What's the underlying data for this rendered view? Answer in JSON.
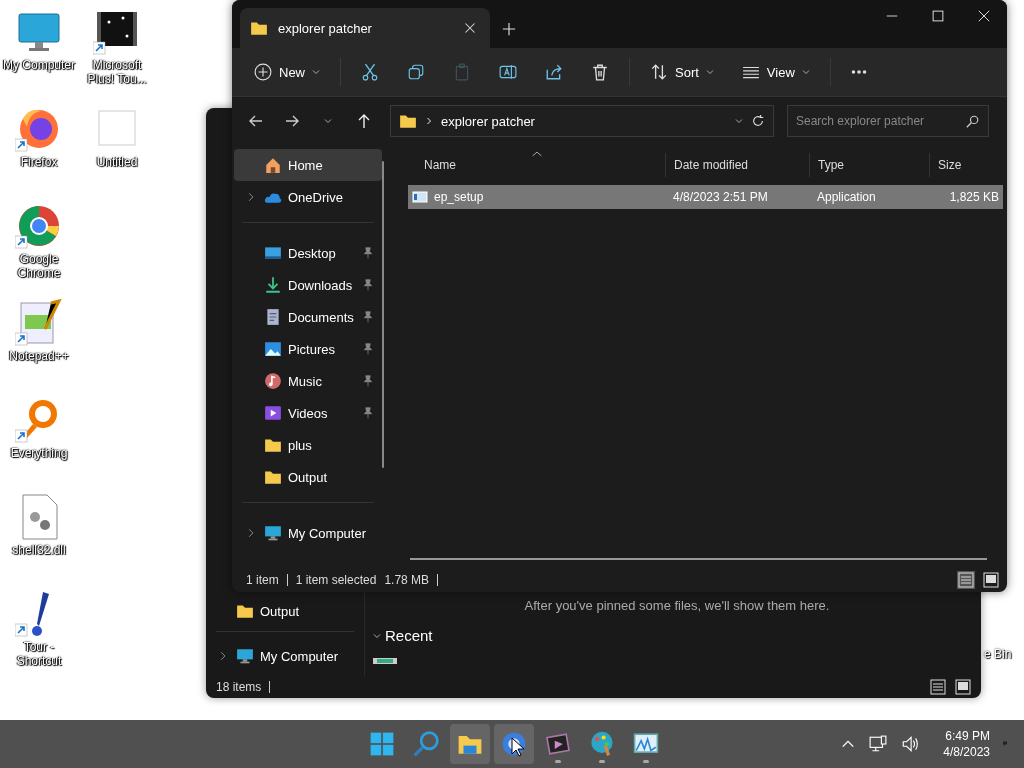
{
  "desktop": {
    "icon_columns": [
      [
        {
          "label": "My Computer",
          "kind": "monitor",
          "shortcut": false
        },
        {
          "label": "Firefox",
          "kind": "firefox",
          "shortcut": true
        },
        {
          "label": "Google Chrome",
          "kind": "chrome",
          "shortcut": true
        },
        {
          "label": "Notepad++",
          "kind": "notepad",
          "shortcut": true
        },
        {
          "label": "Everything",
          "kind": "everything",
          "shortcut": true
        },
        {
          "label": "shell32.dll",
          "kind": "dll",
          "shortcut": false
        },
        {
          "label": "Tour - Shortcut",
          "kind": "tour",
          "shortcut": true
        }
      ],
      [
        {
          "label": "Microsoft Plus! Tou...",
          "kind": "plus",
          "shortcut": true
        },
        {
          "label": "Untitled",
          "kind": "blank",
          "shortcut": false
        }
      ]
    ],
    "partial_icon_label": "e Bin"
  },
  "back_window": {
    "nav_items": [
      {
        "label": "Output",
        "kind": "folder",
        "expandable": false
      },
      {
        "label": "My Computer",
        "kind": "computer",
        "expandable": true
      }
    ],
    "message": "After you've pinned some files, we'll show them here.",
    "section": {
      "title": "Recent",
      "expanded": true
    },
    "status": "18 items"
  },
  "window": {
    "tab": {
      "title": "explorer patcher"
    },
    "toolbar": [
      {
        "kind": "new",
        "label": "New",
        "disabled": false
      },
      {
        "kind": "cut",
        "disabled": false
      },
      {
        "kind": "copy",
        "disabled": false
      },
      {
        "kind": "paste",
        "disabled": true
      },
      {
        "kind": "rename",
        "disabled": false
      },
      {
        "kind": "share",
        "disabled": false
      },
      {
        "kind": "delete",
        "disabled": false
      },
      {
        "kind": "sort",
        "label": "Sort",
        "disabled": false
      },
      {
        "kind": "view",
        "label": "View",
        "disabled": false
      },
      {
        "kind": "more",
        "disabled": false
      }
    ],
    "address": {
      "path": "explorer patcher"
    },
    "search": {
      "placeholder": "Search explorer patcher"
    },
    "nav_groups": [
      [
        {
          "label": "Home",
          "kind": "home",
          "selected": true,
          "pinned": false,
          "expandable": false
        },
        {
          "label": "OneDrive",
          "kind": "onedrive",
          "selected": false,
          "pinned": false,
          "expandable": true
        }
      ],
      [
        {
          "label": "Desktop",
          "kind": "desktop",
          "selected": false,
          "pinned": true,
          "expandable": false
        },
        {
          "label": "Downloads",
          "kind": "downloads",
          "selected": false,
          "pinned": true,
          "expandable": false
        },
        {
          "label": "Documents",
          "kind": "documents",
          "selected": false,
          "pinned": true,
          "expandable": false
        },
        {
          "label": "Pictures",
          "kind": "pictures",
          "selected": false,
          "pinned": true,
          "expandable": false
        },
        {
          "label": "Music",
          "kind": "music",
          "selected": false,
          "pinned": true,
          "expandable": false
        },
        {
          "label": "Videos",
          "kind": "videos",
          "selected": false,
          "pinned": true,
          "expandable": false
        },
        {
          "label": "plus",
          "kind": "folder",
          "selected": false,
          "pinned": false,
          "expandable": false
        },
        {
          "label": "Output",
          "kind": "folder",
          "selected": false,
          "pinned": false,
          "expandable": false
        }
      ],
      [
        {
          "label": "My Computer",
          "kind": "computer",
          "selected": false,
          "pinned": false,
          "expandable": true
        }
      ]
    ],
    "columns": [
      "Name",
      "Date modified",
      "Type",
      "Size"
    ],
    "files": [
      {
        "name": "ep_setup",
        "date_modified": "4/8/2023 2:51 PM",
        "type": "Application",
        "size": "1,825 KB",
        "selected": true
      }
    ],
    "status": {
      "count": "1 item",
      "selection": "1 item selected",
      "selection_size": "1.78 MB"
    }
  },
  "taskbar": {
    "apps": [
      {
        "kind": "start",
        "highlighted": false,
        "running": false
      },
      {
        "kind": "search",
        "highlighted": false,
        "running": false
      },
      {
        "kind": "explorer",
        "highlighted": true,
        "running": false
      },
      {
        "kind": "browser",
        "highlighted": true,
        "running": false
      },
      {
        "kind": "video",
        "highlighted": false,
        "running": true
      },
      {
        "kind": "paint",
        "highlighted": false,
        "running": true
      },
      {
        "kind": "monitor",
        "highlighted": false,
        "running": true
      }
    ],
    "time": "6:49 PM",
    "date": "4/8/2023"
  }
}
